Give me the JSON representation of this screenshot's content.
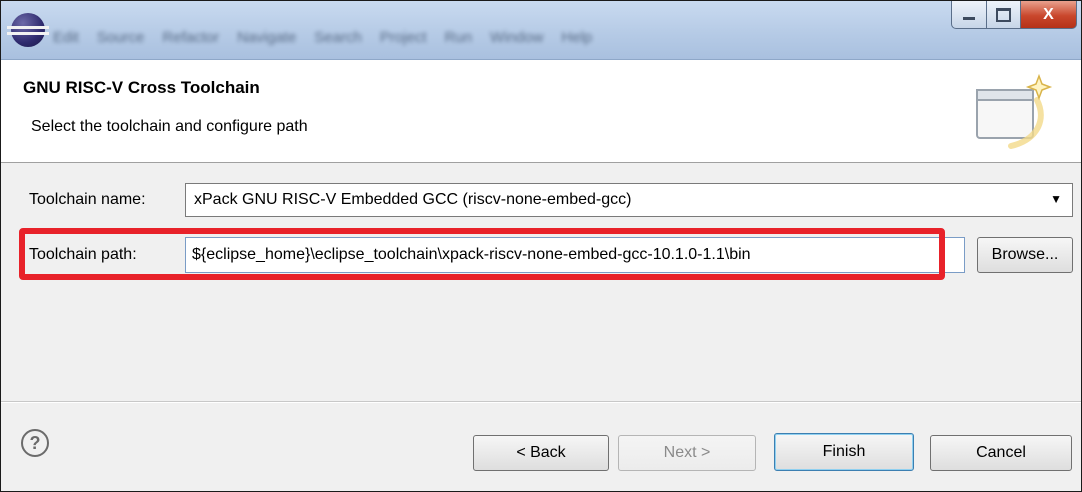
{
  "window": {
    "menu_items": [
      "Edit",
      "Source",
      "Refactor",
      "Navigate",
      "Search",
      "Project",
      "Run",
      "Window",
      "Help"
    ],
    "controls": {
      "minimize": "minimize",
      "maximize": "maximize",
      "close": "X"
    }
  },
  "banner": {
    "title": "GNU RISC-V Cross Toolchain",
    "description": "Select the toolchain and configure path",
    "icon": "wizard-banner-icon"
  },
  "form": {
    "toolchain_name_label": "Toolchain name:",
    "toolchain_name_value": "xPack GNU RISC-V Embedded GCC (riscv-none-embed-gcc)",
    "toolchain_path_label": "Toolchain path:",
    "toolchain_path_value": "${eclipse_home}\\eclipse_toolchain\\xpack-riscv-none-embed-gcc-10.1.0-1.1\\bin",
    "browse_label": "Browse..."
  },
  "buttons": {
    "help_icon": "?",
    "back": "< Back",
    "next": "Next >",
    "finish": "Finish",
    "cancel": "Cancel"
  },
  "colors": {
    "highlight": "#e8222a",
    "titlebar": "#b6cbe6",
    "close_button": "#c9472c"
  }
}
